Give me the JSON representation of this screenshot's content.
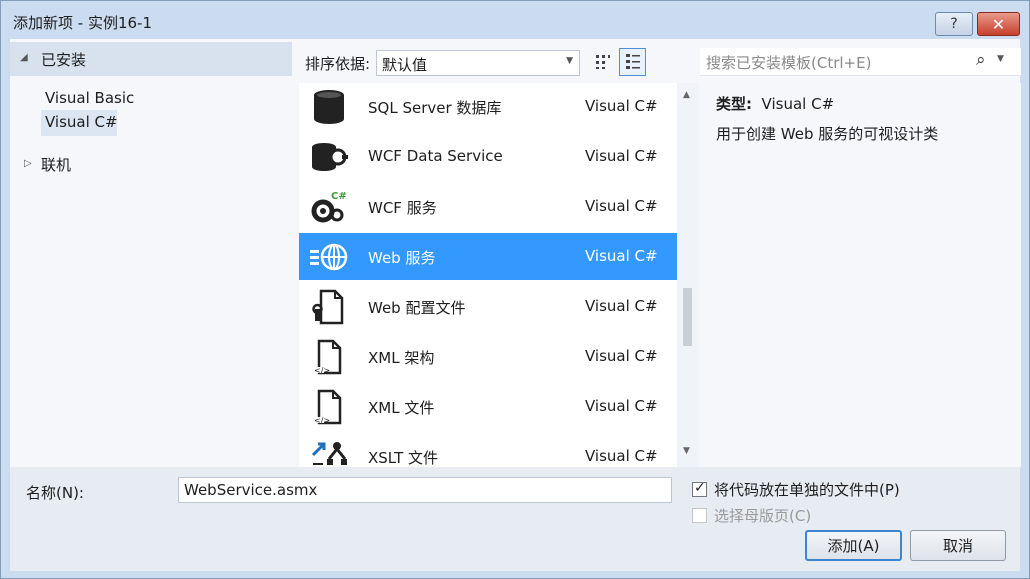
{
  "window": {
    "title": "添加新项 - 实例16-1",
    "help_label": "?",
    "close_label": "✕"
  },
  "tree": {
    "installed": "已安装",
    "items": [
      {
        "label": "Visual Basic"
      },
      {
        "label": "Visual C#"
      }
    ],
    "online": "联机"
  },
  "toolbar": {
    "sort_label": "排序依据:",
    "sort_value": "默认值"
  },
  "search": {
    "placeholder": "搜索已安装模板(Ctrl+E)"
  },
  "templates": [
    {
      "name": "SQL Server 数据库",
      "lang": "Visual C#",
      "icon": "database-icon"
    },
    {
      "name": "WCF Data Service",
      "lang": "Visual C#",
      "icon": "data-service-icon"
    },
    {
      "name": "WCF 服务",
      "lang": "Visual C#",
      "icon": "wcf-service-icon"
    },
    {
      "name": "Web 服务",
      "lang": "Visual C#",
      "icon": "web-service-icon",
      "selected": true
    },
    {
      "name": "Web 配置文件",
      "lang": "Visual C#",
      "icon": "config-file-icon"
    },
    {
      "name": "XML 架构",
      "lang": "Visual C#",
      "icon": "xml-schema-icon"
    },
    {
      "name": "XML 文件",
      "lang": "Visual C#",
      "icon": "xml-file-icon"
    },
    {
      "name": "XSLT 文件",
      "lang": "Visual C#",
      "icon": "xslt-file-icon"
    }
  ],
  "details": {
    "type_label": "类型:",
    "type_value": "Visual C#",
    "description": "用于创建 Web 服务的可视设计类"
  },
  "footer": {
    "name_label": "名称(N):",
    "name_value": "WebService.asmx",
    "separate_file_label": "将代码放在单独的文件中(P)",
    "separate_file_checked": true,
    "master_page_label": "选择母版页(C)",
    "master_page_checked": false,
    "add_label": "添加(A)",
    "cancel_label": "取消"
  },
  "colors": {
    "selection": "#3399ff",
    "accent": "#3a86d0"
  }
}
